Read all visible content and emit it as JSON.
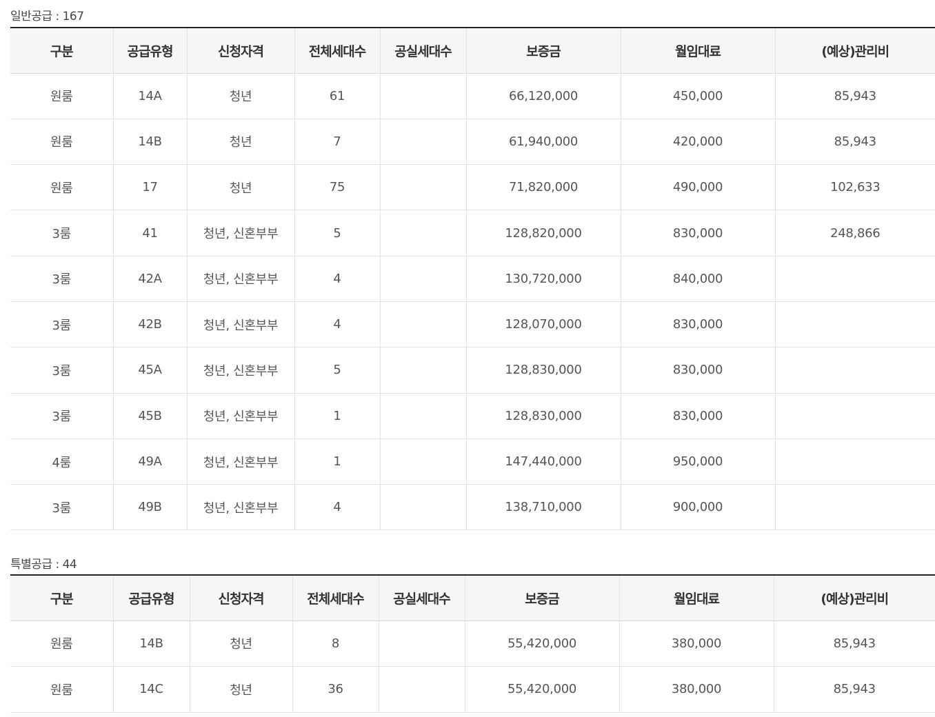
{
  "general": {
    "title": "일반공급 : 167",
    "headers": [
      "구분",
      "공급유형",
      "신청자격",
      "전체세대수",
      "공실세대수",
      "보증금",
      "월임대료",
      "(예상)관리비"
    ],
    "rows": [
      [
        "원룸",
        "14A",
        "청년",
        "61",
        "",
        "66,120,000",
        "450,000",
        "85,943"
      ],
      [
        "원룸",
        "14B",
        "청년",
        "7",
        "",
        "61,940,000",
        "420,000",
        "85,943"
      ],
      [
        "원룸",
        "17",
        "청년",
        "75",
        "",
        "71,820,000",
        "490,000",
        "102,633"
      ],
      [
        "3룸",
        "41",
        "청년, 신혼부부",
        "5",
        "",
        "128,820,000",
        "830,000",
        "248,866"
      ],
      [
        "3룸",
        "42A",
        "청년, 신혼부부",
        "4",
        "",
        "130,720,000",
        "840,000",
        ""
      ],
      [
        "3룸",
        "42B",
        "청년, 신혼부부",
        "4",
        "",
        "128,070,000",
        "830,000",
        ""
      ],
      [
        "3룸",
        "45A",
        "청년, 신혼부부",
        "5",
        "",
        "128,830,000",
        "830,000",
        ""
      ],
      [
        "3룸",
        "45B",
        "청년, 신혼부부",
        "1",
        "",
        "128,830,000",
        "830,000",
        ""
      ],
      [
        "4룸",
        "49A",
        "청년, 신혼부부",
        "1",
        "",
        "147,440,000",
        "950,000",
        ""
      ],
      [
        "3룸",
        "49B",
        "청년, 신혼부부",
        "4",
        "",
        "138,710,000",
        "900,000",
        ""
      ]
    ]
  },
  "special": {
    "title": "특별공급 : 44",
    "headers": [
      "구분",
      "공급유형",
      "신청자격",
      "전체세대수",
      "공실세대수",
      "보증금",
      "월임대료",
      "(예상)관리비"
    ],
    "rows": [
      [
        "원룸",
        "14B",
        "청년",
        "8",
        "",
        "55,420,000",
        "380,000",
        "85,943"
      ],
      [
        "원룸",
        "14C",
        "청년",
        "36",
        "",
        "55,420,000",
        "380,000",
        "85,943"
      ]
    ]
  },
  "colors": {
    "header_bg": "#f6f6f6",
    "top_rule": "#222222",
    "grid": "#e2e2e2",
    "text": "#555555"
  }
}
